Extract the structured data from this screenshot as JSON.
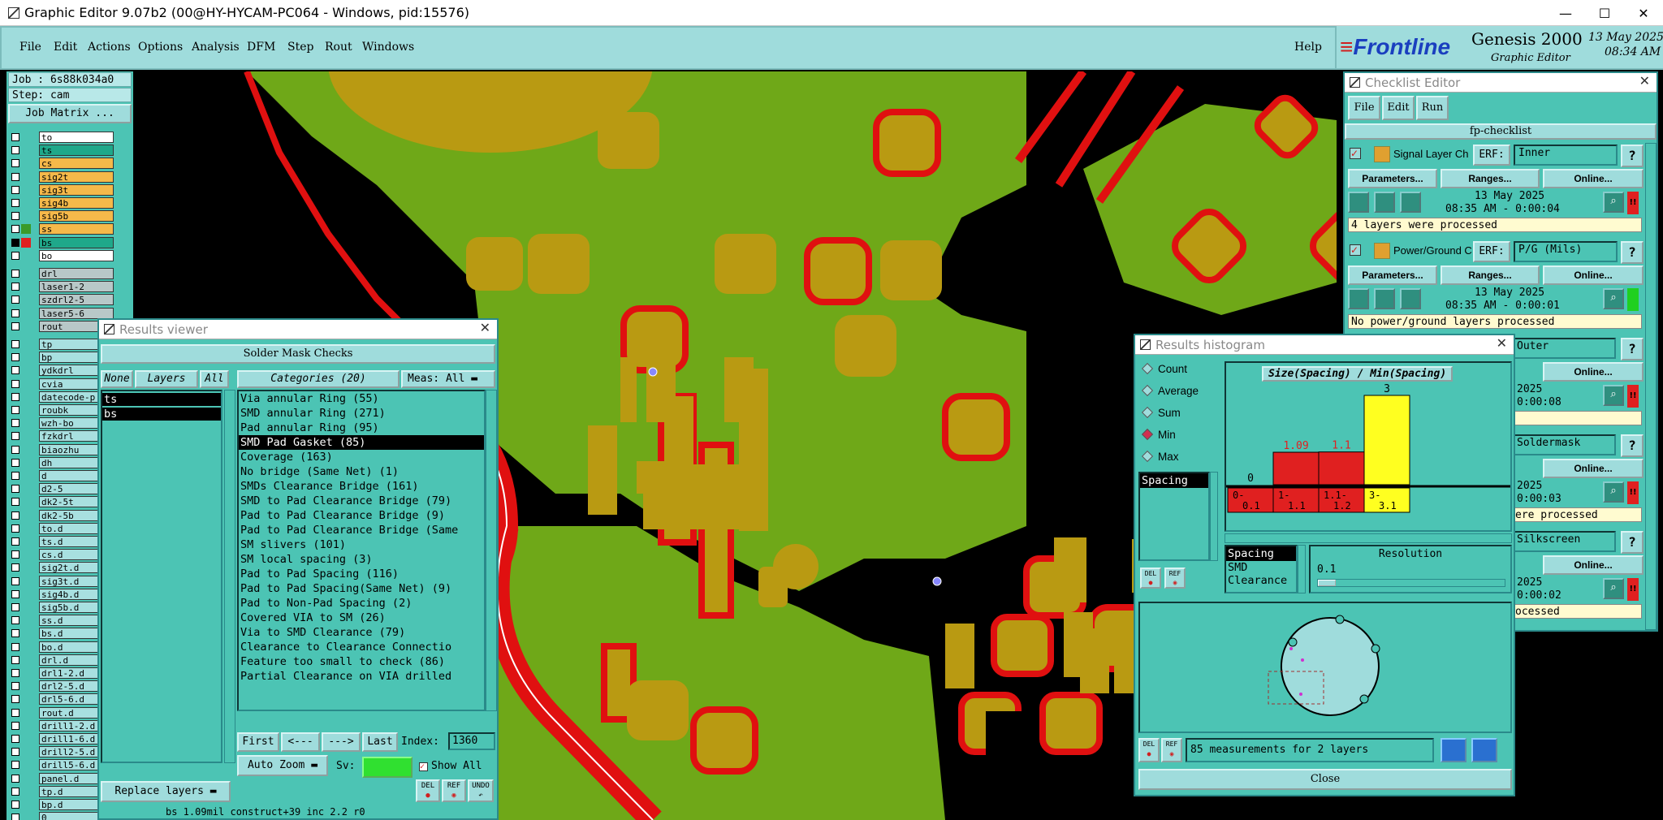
{
  "titlebar": {
    "title": "Graphic Editor 9.07b2 (00@HY-HYCAM-PC064 - Windows, pid:15576)",
    "minimize": "—",
    "maximize": "☐",
    "close": "✕"
  },
  "menu": {
    "items": [
      "File",
      "Edit",
      "Actions",
      "Options",
      "Analysis",
      "DFM",
      "Step",
      "Rout",
      "Windows"
    ],
    "help": "Help"
  },
  "brand": {
    "logo": "Frontline",
    "product": "Genesis 2000",
    "subtitle": "Graphic Editor",
    "date": "13 May 2025",
    "time": "08:34 AM"
  },
  "left_panel": {
    "job": "Job : 6s88k034a0",
    "step": "Step: cam",
    "job_matrix": "Job Matrix ...",
    "layers": [
      {
        "name": "to",
        "color": "#ffffff"
      },
      {
        "name": "ts",
        "color": "#1fa88a"
      },
      {
        "name": "cs",
        "color": "#f5b94a"
      },
      {
        "name": "sig2t",
        "color": "#f5b94a"
      },
      {
        "name": "sig3t",
        "color": "#f5b94a"
      },
      {
        "name": "sig4b",
        "color": "#f5b94a"
      },
      {
        "name": "sig5b",
        "color": "#f5b94a"
      },
      {
        "name": "ss",
        "color": "#f5b94a"
      },
      {
        "name": "bs",
        "color": "#1fa88a"
      },
      {
        "name": "bo",
        "color": "#ffffff"
      },
      {
        "name": "drl",
        "color": "#b8c8c8"
      },
      {
        "name": "laser1-2",
        "color": "#b8c8c8"
      },
      {
        "name": "szdrl2-5",
        "color": "#b8c8c8"
      },
      {
        "name": "laser5-6",
        "color": "#b8c8c8"
      },
      {
        "name": "rout",
        "color": "#b8c8c8"
      },
      {
        "name": "tp",
        "color": "#a8e0e0"
      },
      {
        "name": "bp",
        "color": "#a8e0e0"
      },
      {
        "name": "ydkdrl",
        "color": "#a8e0e0"
      },
      {
        "name": "cvia",
        "color": "#a8e0e0"
      },
      {
        "name": "datecode-p",
        "color": "#a8e0e0"
      },
      {
        "name": "roubk",
        "color": "#a8e0e0"
      },
      {
        "name": "wzh-bo",
        "color": "#a8e0e0"
      },
      {
        "name": "fzkdrl",
        "color": "#a8e0e0"
      },
      {
        "name": "biaozhu",
        "color": "#a8e0e0"
      },
      {
        "name": "dh",
        "color": "#a8e0e0"
      },
      {
        "name": "d",
        "color": "#a8e0e0"
      },
      {
        "name": "d2-5",
        "color": "#a8e0e0"
      },
      {
        "name": "dk2-5t",
        "color": "#a8e0e0"
      },
      {
        "name": "dk2-5b",
        "color": "#a8e0e0"
      },
      {
        "name": "to.d",
        "color": "#a8e0e0"
      },
      {
        "name": "ts.d",
        "color": "#a8e0e0"
      },
      {
        "name": "cs.d",
        "color": "#a8e0e0"
      },
      {
        "name": "sig2t.d",
        "color": "#a8e0e0"
      },
      {
        "name": "sig3t.d",
        "color": "#a8e0e0"
      },
      {
        "name": "sig4b.d",
        "color": "#a8e0e0"
      },
      {
        "name": "sig5b.d",
        "color": "#a8e0e0"
      },
      {
        "name": "ss.d",
        "color": "#a8e0e0"
      },
      {
        "name": "bs.d",
        "color": "#a8e0e0"
      },
      {
        "name": "bo.d",
        "color": "#a8e0e0"
      },
      {
        "name": "drl.d",
        "color": "#a8e0e0"
      },
      {
        "name": "drl1-2.d",
        "color": "#a8e0e0"
      },
      {
        "name": "drl2-5.d",
        "color": "#a8e0e0"
      },
      {
        "name": "drl5-6.d",
        "color": "#a8e0e0"
      },
      {
        "name": "rout.d",
        "color": "#a8e0e0"
      },
      {
        "name": "drill1-2.d",
        "color": "#a8e0e0"
      },
      {
        "name": "drill1-6.d",
        "color": "#a8e0e0"
      },
      {
        "name": "drill2-5.d",
        "color": "#a8e0e0"
      },
      {
        "name": "drill5-6.d",
        "color": "#a8e0e0"
      },
      {
        "name": "panel.d",
        "color": "#a8e0e0"
      },
      {
        "name": "tp.d",
        "color": "#a8e0e0"
      },
      {
        "name": "bp.d",
        "color": "#a8e0e0"
      },
      {
        "name": "0",
        "color": "#a8e0e0"
      }
    ]
  },
  "results_viewer": {
    "title": "Results viewer",
    "header": "Solder Mask Checks",
    "none_btn": "None",
    "layers_label": "Layers",
    "all_btn": "All",
    "categories_label": "Categories (20)",
    "meas_label": "Meas:",
    "meas_value": "All",
    "layers": [
      "ts",
      "bs"
    ],
    "categories": [
      "Via annular Ring (55)",
      "SMD annular Ring (271)",
      "Pad annular Ring (95)",
      "SMD Pad Gasket (85)",
      "Coverage (163)",
      "No bridge (Same Net) (1)",
      "SMDs Clearance Bridge (161)",
      "SMD to Pad Clearance Bridge (79)",
      "Pad to Pad Clearance Bridge (9)",
      "Pad to Pad Clearance Bridge (Same",
      "SM slivers (101)",
      "SM local spacing (3)",
      "Pad to Pad Spacing (116)",
      "Pad to Pad Spacing(Same Net) (9)",
      "Pad to Non-Pad Spacing (2)",
      "Covered VIA to SM (26)",
      "Via to SMD Clearance (79)",
      "Clearance to Clearance Connectio",
      "Feature too small to check (86)",
      "Partial Clearance on VIA drilled"
    ],
    "selected_index": 3,
    "first": "First",
    "prev": "<---",
    "next": "--->",
    "last": "Last",
    "index_label": "Index:",
    "index_value": "1360",
    "replace_layers": "Replace layers",
    "auto_zoom": "Auto Zoom",
    "sv_label": "Sv:",
    "show_all": "Show All",
    "del": "DEL",
    "ref": "REF",
    "undo": "UNDO",
    "status": "bs 1.09mil  construct+39 inc 2.2  r0"
  },
  "checklist_editor": {
    "title": "Checklist Editor",
    "menu": [
      "File",
      "Edit",
      "Run"
    ],
    "name": "fp-checklist",
    "erf": "ERF:",
    "parameters": "Parameters...",
    "ranges": "Ranges...",
    "online": "Online...",
    "help": "?",
    "items": [
      {
        "label": "Signal Layer Ch",
        "erf": "Inner",
        "date": "13 May 2025",
        "time": "08:35 AM - 0:00:04",
        "status": "4 layers were processed",
        "flag": "!!",
        "flag_color": "#e02020"
      },
      {
        "label": "Power/Ground C",
        "erf": "P/G (Mils)",
        "date": "13 May 2025",
        "time": "08:35 AM - 0:00:01",
        "status": "No power/ground layers processed",
        "flag": "",
        "flag_color": "#20d020"
      },
      {
        "label": "",
        "erf": "Outer",
        "date": "2025",
        "time": "0:00:08",
        "status": "",
        "flag": "!!",
        "flag_color": "#e02020"
      },
      {
        "label": "",
        "erf": "Soldermask",
        "date": "2025",
        "time": "0:00:03",
        "status": "ere processed",
        "flag": "!!",
        "flag_color": "#e02020"
      },
      {
        "label": "",
        "erf": "Silkscreen",
        "date": "2025",
        "time": "0:00:02",
        "status": "ocessed",
        "flag": "!!",
        "flag_color": "#e02020"
      }
    ]
  },
  "histogram": {
    "title": "Results histogram",
    "modes": [
      "Count",
      "Average",
      "Sum",
      "Min",
      "Max"
    ],
    "selected_mode": "Min",
    "measure_list": [
      "Spacing"
    ],
    "chart_title": "Size(Spacing) / Min(Spacing)",
    "category_list": [
      "Spacing",
      "SMD",
      "Clearance"
    ],
    "resolution_label": "Resolution",
    "resolution_value": "0.1",
    "measurements": "85 measurements for 2 layers",
    "close": "Close",
    "del": "DEL",
    "ref": "REF"
  },
  "chart_data": {
    "type": "bar",
    "title": "Size(Spacing) / Min(Spacing)",
    "categories": [
      "0- 0.1",
      "1- 1.1",
      "1.1- 1.2",
      "3- 3.1"
    ],
    "tick_lines": [
      [
        "0-",
        "0.1"
      ],
      [
        "1-",
        "1.1"
      ],
      [
        "1.1-",
        "1.2"
      ],
      [
        "3-",
        "3.1"
      ]
    ],
    "values": [
      0,
      1.09,
      1.1,
      3
    ],
    "value_labels": [
      "0",
      "1.09",
      "1.1",
      "3"
    ],
    "colors": [
      "#e02020",
      "#e02020",
      "#e02020",
      "#ffff20"
    ],
    "label_colors": [
      "#000000",
      "#e02020",
      "#e02020",
      "#000000"
    ],
    "ylim": [
      0,
      3
    ]
  }
}
